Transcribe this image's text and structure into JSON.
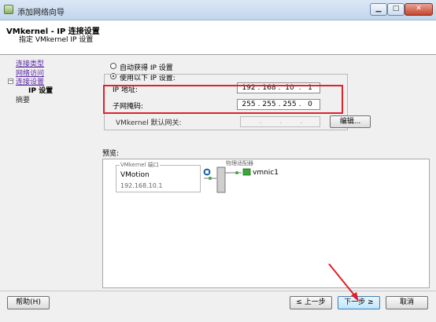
{
  "window": {
    "title": "添加网络向导"
  },
  "header": {
    "title": "VMkernel - IP 连接设置",
    "subtitle": "指定 VMkernel IP 设置"
  },
  "nav": {
    "items": [
      {
        "label": "连接类型"
      },
      {
        "label": "网络访问"
      },
      {
        "label": "连接设置"
      },
      {
        "label": "IP 设置"
      },
      {
        "label": "摘要"
      }
    ]
  },
  "ip_mode": {
    "auto_label": "自动获得 IP 设置",
    "static_label": "使用以下 IP 设置:",
    "selected": "static"
  },
  "fields": {
    "ip_label": "IP 地址:",
    "ip_octets": [
      "192",
      "168",
      "10",
      "1"
    ],
    "mask_label": "子网掩码:",
    "mask_octets": [
      "255",
      "255",
      "255",
      "0"
    ],
    "gateway_label": "VMkernel 默认网关:",
    "gateway_octets": [
      "",
      "",
      "",
      ""
    ],
    "edit_label": "编辑..."
  },
  "preview": {
    "label": "预览:",
    "vmkernel_port_legend": "VMkernel 端口",
    "port_name": "VMotion",
    "port_ip": "192.168.10.1",
    "physical_adapter_legend": "物理适配器",
    "nic_name": "vmnic1"
  },
  "footer": {
    "help_label": "帮助(H)",
    "back_label": "≤ 上一步",
    "next_label": "下一步 ≥",
    "cancel_label": "取消"
  },
  "colors": {
    "highlight": "#e0202a",
    "link": "#5b2aa6",
    "nic_green": "#3aa83a"
  }
}
